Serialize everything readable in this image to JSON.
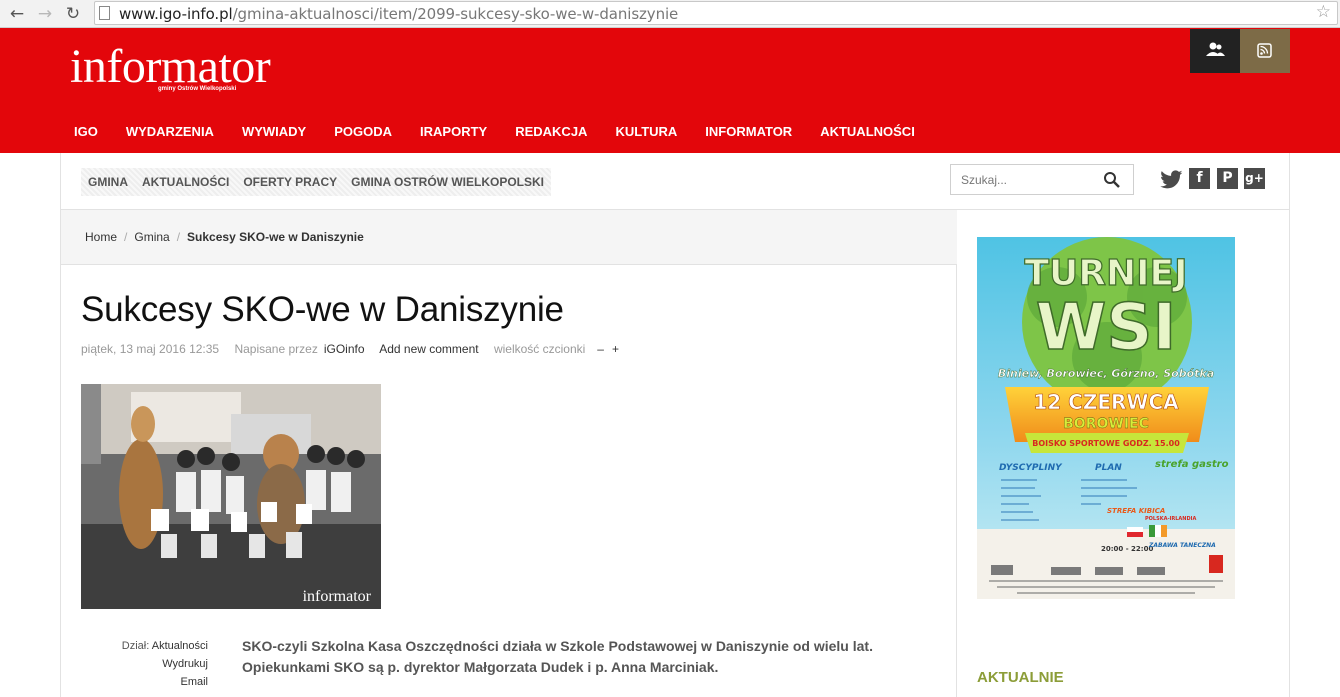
{
  "browser": {
    "url_domain": "www.igo-info.pl",
    "url_path": "/gmina-aktualnosci/item/2099-sukcesy-sko-we-w-daniszynie"
  },
  "header": {
    "logo": "informator",
    "logo_sub": "gminy Ostrów Wielkopolski",
    "brand_color": "#e3060b",
    "nav": [
      "IGO",
      "WYDARZENIA",
      "WYWIADY",
      "POGODA",
      "IRAPORTY",
      "REDAKCJA",
      "KULTURA",
      "INFORMATOR",
      "AKTUALNOŚCI"
    ]
  },
  "subnav": {
    "items": [
      "GMINA",
      "AKTUALNOŚCI",
      "OFERTY PRACY",
      "GMINA OSTRÓW WIELKOPOLSKI"
    ],
    "search_placeholder": "Szukaj...",
    "social": [
      "twitter-icon",
      "facebook-icon",
      "pinterest-icon",
      "google-plus-icon"
    ]
  },
  "breadcrumb": {
    "home": "Home",
    "section": "Gmina",
    "current": "Sukcesy SKO-we w Daniszynie"
  },
  "article": {
    "title": "Sukcesy SKO-we w Daniszynie",
    "date": "piątek, 13 maj 2016 12:35",
    "written_by": "Napisane przez",
    "author": "iGOinfo",
    "add_comment": "Add new comment",
    "font_size_label": "wielkość czcionki",
    "font_decrease": "–",
    "font_increase": "+",
    "photo_caption": "informator",
    "side_dzial_label": "Dział:",
    "side_dzial_value": "Aktualności",
    "side_print": "Wydrukuj",
    "side_email": "Email",
    "lead": "SKO-czyli Szkolna Kasa Oszczędności działa w Szkole Podstawowej w Daniszynie od wielu lat. Opiekunkami SKO są p. dyrektor Małgorzata Dudek i p. Anna Marciniak."
  },
  "sidebar": {
    "poster": {
      "title1": "TURNIEJ",
      "title2": "WSI",
      "villages": "Biniew, Borowiec, Górzno, Sobótka",
      "date": "12 CZERWCA",
      "place": "BOROWIEC",
      "venue": "BOISKO SPORTOWE GODZ. 15.00",
      "col1": "DYSCYPLINY",
      "col2": "PLAN",
      "col3": "strefa gastro",
      "kibic": "STREFA KIBICA",
      "match": "POLSKA-IRLANDIA",
      "time": "20:00 - 22:00",
      "dance": "ZABAWA TANECZNA"
    },
    "heading": "AKTUALNIE",
    "heading_color": "#8c9d38"
  }
}
